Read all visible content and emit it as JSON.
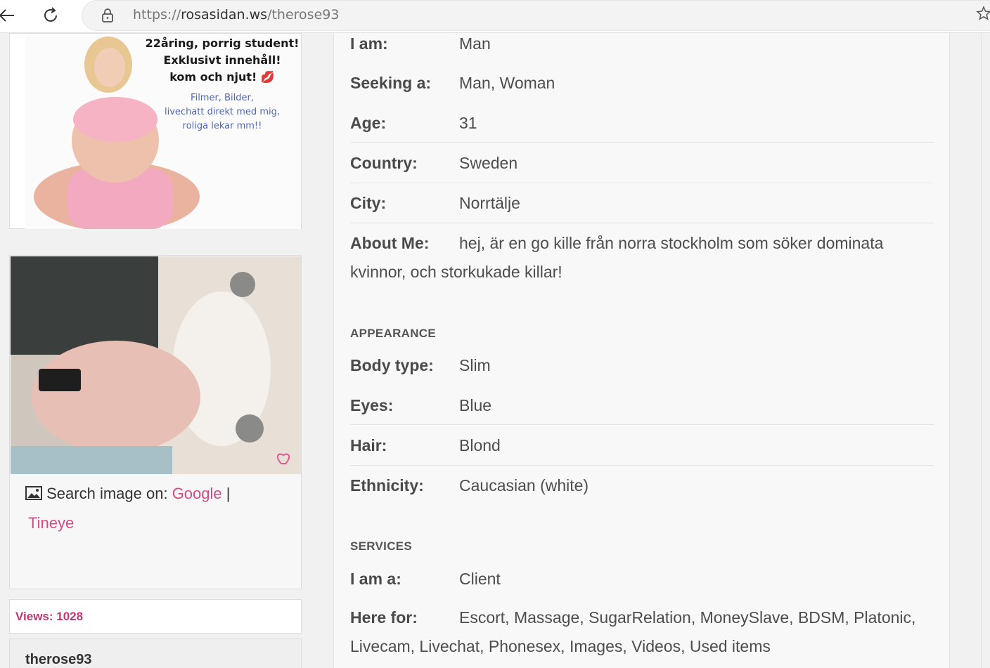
{
  "browser": {
    "url_scheme": "https://",
    "url_host": "rosasidan.ws",
    "url_path": "/therose93"
  },
  "ad": {
    "headline": [
      "22åring, porrig student!",
      "Exklusivt innehåll!",
      "kom och njut! 💋"
    ],
    "subline": [
      "Filmer, Bilder,",
      "livechatt direkt med mig,",
      "roliga lekar mm!!"
    ]
  },
  "photo_card": {
    "search_label": "Search image on:",
    "google": "Google",
    "separator": "|",
    "tineye": "Tineye"
  },
  "views": "Views: 1028",
  "username": "therose93",
  "profile": {
    "i_am": {
      "label": "I am:",
      "value": "Man"
    },
    "seeking": {
      "label": "Seeking a:",
      "value": "Man, Woman"
    },
    "age": {
      "label": "Age:",
      "value": "31"
    },
    "country": {
      "label": "Country:",
      "value": "Sweden"
    },
    "city": {
      "label": "City:",
      "value": "Norrtälje"
    },
    "about": {
      "label": "About Me:",
      "value": "hej, är en go kille från norra stockholm som söker dominata kvinnor, och storkukade killar!"
    }
  },
  "appearance": {
    "title": "APPEARANCE",
    "body": {
      "label": "Body type:",
      "value": "Slim"
    },
    "eyes": {
      "label": "Eyes:",
      "value": "Blue"
    },
    "hair": {
      "label": "Hair:",
      "value": "Blond"
    },
    "ethnicity": {
      "label": "Ethnicity:",
      "value": "Caucasian (white)"
    }
  },
  "services": {
    "title": "SERVICES",
    "i_am_a": {
      "label": "I am a:",
      "value": "Client"
    },
    "here_for": {
      "label": "Here for:",
      "value": "Escort, Massage, SugarRelation, MoneySlave, BDSM, Platonic, Livecam, Livechat, Phonesex, Images, Videos, Used items"
    }
  },
  "colors": {
    "link": "#d54b86",
    "views": "#c0386f"
  }
}
